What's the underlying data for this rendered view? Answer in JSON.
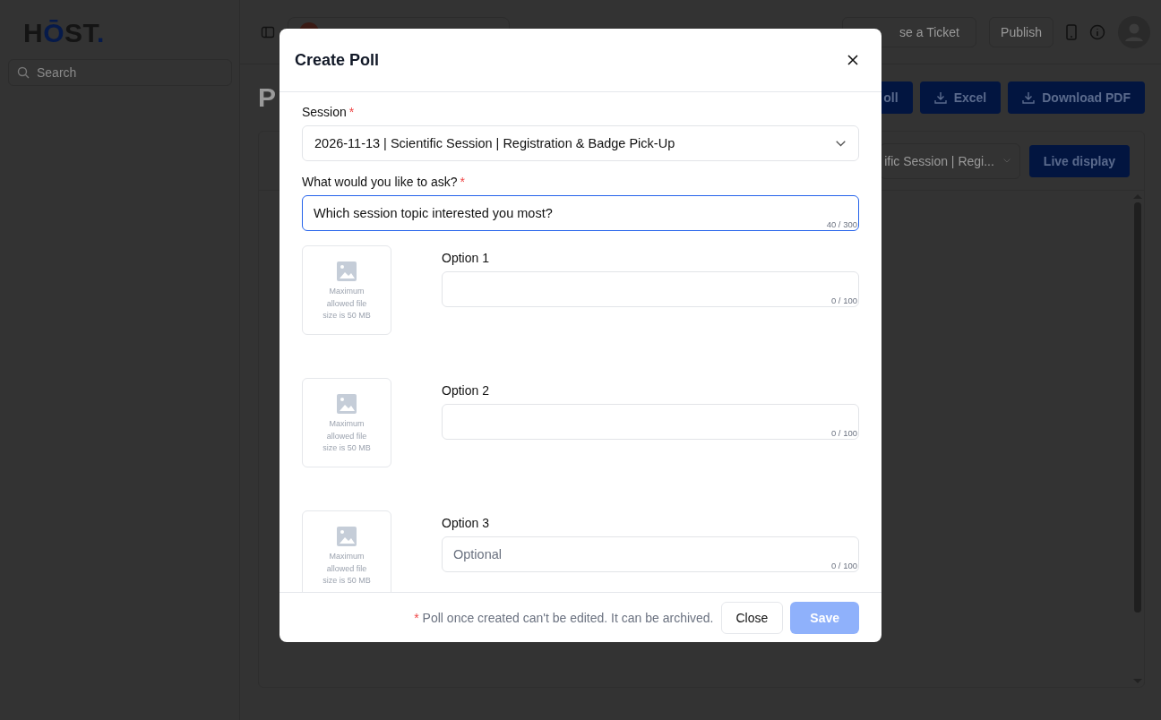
{
  "sidebar": {
    "logo": [
      {
        "text": "H",
        "accent": false
      },
      {
        "text": "Ō",
        "accent": true
      },
      {
        "text": "ST",
        "accent": false
      },
      {
        "text": ".",
        "accent": true
      }
    ],
    "search": {
      "placeholder": "Search"
    }
  },
  "topbar": {
    "ticket_button": "se a Ticket",
    "publish_button": "Publish"
  },
  "page": {
    "title": "P",
    "actions": [
      {
        "label": "oll",
        "kind": "plain"
      },
      {
        "label": "Excel",
        "kind": "download"
      },
      {
        "label": "Download PDF",
        "kind": "download"
      }
    ],
    "session_select": "ific Session | Regi...",
    "live_button": "Live display"
  },
  "modal": {
    "title": "Create Poll",
    "session": {
      "label": "Session",
      "required_mark": "*",
      "value": "2026-11-13 | Scientific Session | Registration & Badge Pick-Up"
    },
    "question": {
      "label": "What would you like to ask?",
      "required_mark": "*",
      "value": "Which session topic interested you most?",
      "counter": "40 / 300"
    },
    "options": [
      {
        "label": "Option 1",
        "counter": "0 / 100",
        "image_hint": "Maximum allowed file size is 50 MB"
      },
      {
        "label": "Option 2",
        "counter": "0 / 100",
        "image_hint": "Maximum allowed file size is 50 MB"
      },
      {
        "label": "Option 3",
        "placeholder": "Optional",
        "counter": "0 / 100",
        "image_hint": "Maximum allowed file size is 50 MB"
      }
    ],
    "footer": {
      "note_mark": "*",
      "note": "Poll once created can't be edited. It can be archived.",
      "buttons": [
        {
          "label": "Close",
          "kind": "secondary",
          "disabled": false
        },
        {
          "label": "Save",
          "kind": "primary",
          "disabled": true
        }
      ]
    }
  }
}
